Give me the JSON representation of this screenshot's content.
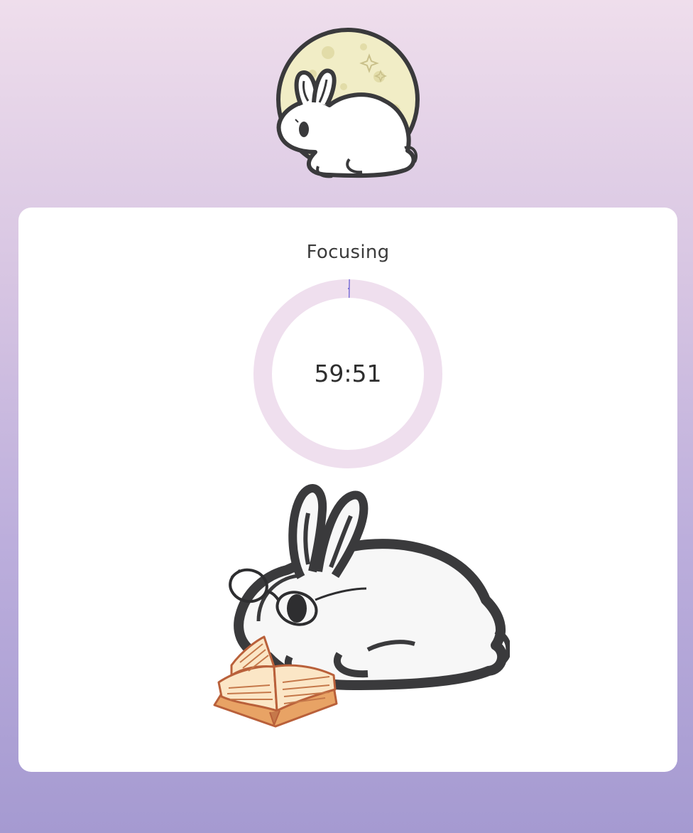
{
  "app": {
    "logo_icon": "rabbit-moon-logo-icon"
  },
  "timer": {
    "status_label": "Focusing",
    "time_display": "59:51",
    "progress_fraction": 0.0025,
    "ring_track_color": "#efdfee",
    "ring_progress_color": "#7b6fd6"
  },
  "illustration": {
    "icon": "rabbit-reading-book-icon"
  },
  "colors": {
    "background_top": "#efdeec",
    "background_bottom": "#a59ad1",
    "card": "#ffffff",
    "moon": "#f1edc6",
    "rabbit_outline": "#3a3a3c"
  }
}
